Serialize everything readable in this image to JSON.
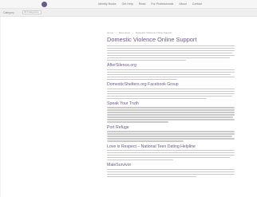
{
  "header": {
    "logo_text": "",
    "nav": [
      "Identity Books",
      "Get Help",
      "Read",
      "For Professionals",
      "About",
      "Contact"
    ]
  },
  "subbar": {
    "label": "Category",
    "select_value": "All Categories"
  },
  "breadcrumb": [
    "Home",
    "Resources",
    "Domestic Violence Online Support"
  ],
  "page_title": "Domestic Violence Online Support",
  "sections": [
    {
      "title": "",
      "lines": [
        100,
        100,
        100,
        98,
        100,
        96,
        62
      ]
    },
    {
      "title": "AfterSilence.org",
      "lines": [
        100,
        100,
        97,
        100,
        55
      ]
    },
    {
      "title": "DomesticShelters.org Facebook Group",
      "lines": [
        100,
        100,
        100,
        98,
        78
      ]
    },
    {
      "title": "Speak Your Truth",
      "lines": [
        100,
        100,
        100,
        100,
        99,
        100,
        48
      ]
    },
    {
      "title": "Port Refuge",
      "lines": [
        100,
        100,
        98,
        100,
        60
      ]
    },
    {
      "title": "Love is Respect – National Teen Dating Helpline",
      "lines": [
        100,
        100,
        100,
        96,
        52
      ]
    },
    {
      "title": "MaleSurvivor",
      "lines": [
        100,
        100,
        100,
        70
      ]
    }
  ]
}
